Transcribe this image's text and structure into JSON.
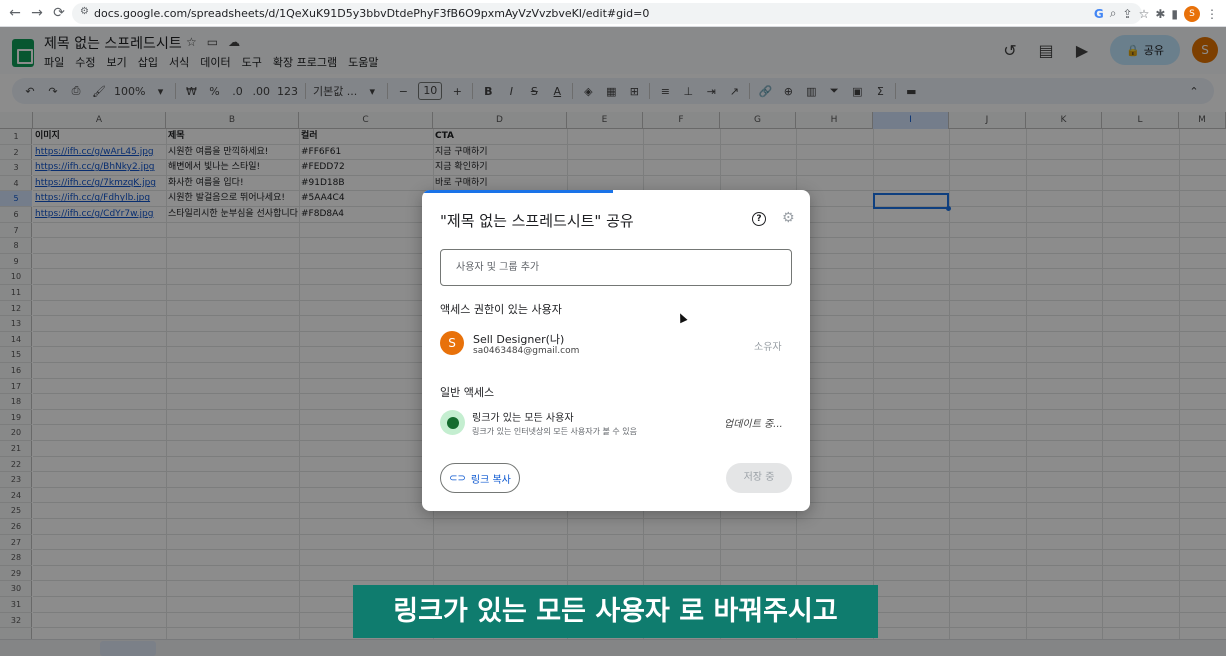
{
  "browser": {
    "url": "docs.google.com/spreadsheets/d/1QeXuK91D5y3bbvDtdePhyF3fB6O9pxmAyVzVvzbveKI/edit#gid=0",
    "profile_initial": "S"
  },
  "sheet": {
    "title": "제목 없는 스프레드시트",
    "menu": [
      "파일",
      "수정",
      "보기",
      "삽입",
      "서식",
      "데이터",
      "도구",
      "확장 프로그램",
      "도움말"
    ],
    "share_label": "공유",
    "avatar_initial": "S",
    "toolbar": {
      "zoom": "100%",
      "currency": "₩",
      "percent": "%",
      "dec_dec": ".0",
      "inc_dec": ".00",
      "number_format": "123",
      "font": "기본값 ...",
      "font_size": "10"
    },
    "columns": [
      "A",
      "B",
      "C",
      "D",
      "E",
      "F",
      "G",
      "H",
      "I",
      "J",
      "K",
      "L",
      "M"
    ],
    "selected_column": "I",
    "selected_row": 5,
    "rows": [
      "1",
      "2",
      "3",
      "4",
      "5",
      "6",
      "7",
      "8",
      "9",
      "10",
      "11",
      "12",
      "13",
      "14",
      "15",
      "16",
      "17",
      "18",
      "19",
      "20",
      "21",
      "22",
      "23",
      "24",
      "25",
      "26",
      "27",
      "28",
      "29",
      "30",
      "31",
      "32"
    ],
    "headers": {
      "a": "이미지",
      "b": "제목",
      "c": "컬러",
      "d": "CTA"
    },
    "data": [
      {
        "a": "https://ifh.cc/g/wArL45.jpg",
        "b": "시원한 여름을 만끽하세요!",
        "c": "#FF6F61",
        "d": "지금 구매하기"
      },
      {
        "a": "https://ifh.cc/g/BhNky2.jpg",
        "b": "해변에서 빛나는 스타일!",
        "c": "#FEDD72",
        "d": "지금 확인하기"
      },
      {
        "a": "https://ifh.cc/g/7kmzqK.jpg",
        "b": "화사한 여름을 입다!",
        "c": "#91D18B",
        "d": "바로 구매하기"
      },
      {
        "a": "https://ifh.cc/g/Fdhylb.jpg",
        "b": "시원한 발걸음으로 뛰어나세요!",
        "c": "#5AA4C4",
        "d": ""
      },
      {
        "a": "https://ifh.cc/g/CdYr7w.jpg",
        "b": "스타일리시한 눈부심을 선사합니다",
        "c": "#F8D8A4",
        "d": ""
      }
    ]
  },
  "dialog": {
    "title": "\"제목 없는 스프레드시트\" 공유",
    "add_placeholder": "사용자 및 그룹 추가",
    "access_heading": "액세스 권한이 있는 사용자",
    "user": {
      "initial": "S",
      "name": "Sell Designer(나)",
      "email": "sa0463484@gmail.com",
      "role": "소유자"
    },
    "general_heading": "일반 액세스",
    "link_access": {
      "title": "링크가 있는 모든 사용자",
      "description": "링크가 있는 인터넷상의 모든 사용자가 볼 수 있음",
      "status": "업데이트 중..."
    },
    "copy_link_label": "링크 복사",
    "save_label": "저장 중"
  },
  "subtitle": "링크가 있는 모든 사용자 로 바꿔주시고",
  "colors": {
    "accent": "#1a73e8",
    "share_bg": "#c2e7ff",
    "subtitle_bg": "#0f7c6e",
    "avatar": "#e8710a"
  }
}
